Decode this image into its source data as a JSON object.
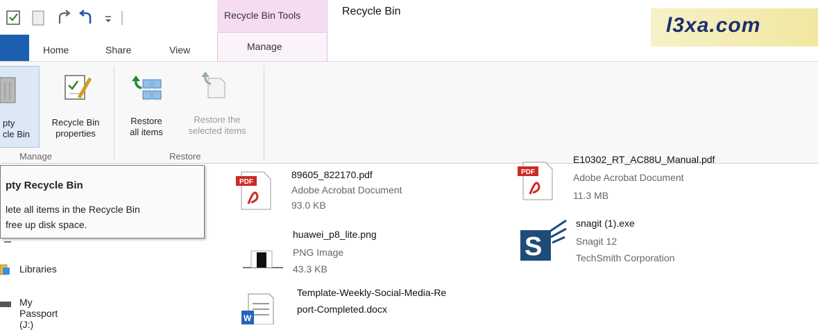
{
  "window": {
    "title": "Recycle Bin",
    "contextual_tab_header": "Recycle Bin Tools"
  },
  "watermark": "l3xa.com",
  "ribbon": {
    "tabs": [
      "Home",
      "Share",
      "View",
      "Manage"
    ],
    "groups": {
      "manage": {
        "label": "Manage",
        "buttons": [
          {
            "line1": "pty",
            "line2": "cle Bin",
            "icon": "recycle-bin-icon"
          },
          {
            "line1": "Recycle Bin",
            "line2": "properties",
            "icon": "properties-icon"
          }
        ]
      },
      "restore": {
        "label": "Restore",
        "buttons": [
          {
            "line1": "Restore",
            "line2": "all items",
            "icon": "restore-all-icon"
          },
          {
            "line1": "Restore the",
            "line2": "selected items",
            "icon": "restore-selected-icon",
            "disabled": true
          }
        ]
      }
    }
  },
  "tooltip": {
    "title": "pty Recycle Bin",
    "line1": "lete all items in the Recycle Bin",
    "line2": "free up disk space."
  },
  "navigation": [
    {
      "label": "Libraries",
      "icon": "libraries-icon"
    },
    {
      "label": "My Passport (J:)",
      "icon": "drive-icon"
    }
  ],
  "files": [
    {
      "name": "89605_822170.pdf",
      "type": "Adobe Acrobat Document",
      "detail": "93.0 KB",
      "icon": "pdf-icon"
    },
    {
      "name": "huawei_p8_lite.png",
      "type": "PNG Image",
      "detail": "43.3 KB",
      "icon": "png-thumbnail-icon"
    },
    {
      "name_line1": "Template-Weekly-Social-Media-Re",
      "name_line2": "port-Completed.docx",
      "icon": "word-document-icon"
    },
    {
      "name": "E10302_RT_AC88U_Manual.pdf",
      "type": "Adobe Acrobat Document",
      "detail": "11.3 MB",
      "icon": "pdf-icon"
    },
    {
      "name": "snagit (1).exe",
      "type": "Snagit 12",
      "detail": "TechSmith Corporation",
      "icon": "snagit-icon"
    }
  ],
  "colors": {
    "context_tab": "#f5dcf2",
    "file_tab": "#1c5fb0",
    "pdf_red": "#cc2b25",
    "accent_blue": "#2565b8"
  }
}
